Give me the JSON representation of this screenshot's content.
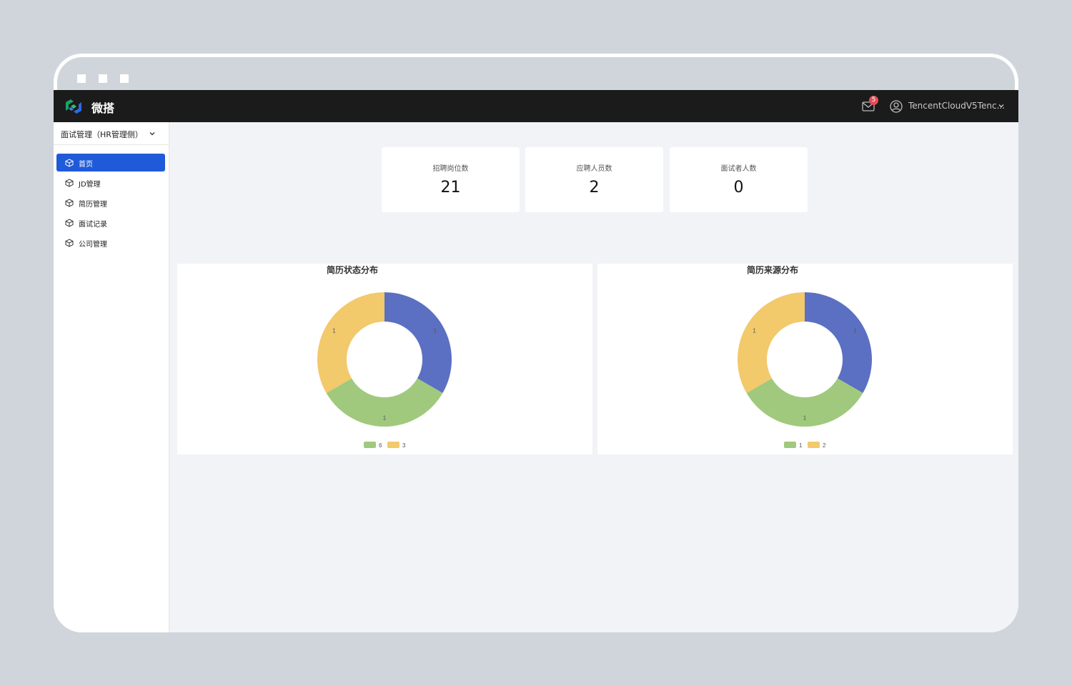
{
  "app": {
    "brand": "微搭"
  },
  "header": {
    "notification_count": "5",
    "username": "TencentCloudV5Tenc..."
  },
  "sidebar": {
    "system_select": "面试管理（HR管理侧）",
    "items": [
      {
        "label": "首页",
        "active": true
      },
      {
        "label": "JD管理",
        "active": false
      },
      {
        "label": "简历管理",
        "active": false
      },
      {
        "label": "面试记录",
        "active": false
      },
      {
        "label": "公司管理",
        "active": false
      }
    ]
  },
  "stats": [
    {
      "label": "招聘岗位数",
      "value": "21"
    },
    {
      "label": "应聘人员数",
      "value": "2"
    },
    {
      "label": "面试者人数",
      "value": "0"
    }
  ],
  "colors": {
    "accent": "#1f5ad8",
    "badge": "#e34d59",
    "series": [
      "#5b70c2",
      "#a0c97d",
      "#f2c96b"
    ]
  },
  "chart_data": [
    {
      "type": "pie",
      "title": "简历状态分布",
      "slices": [
        {
          "label": "",
          "value": 1,
          "color": "#5b70c2"
        },
        {
          "label": "",
          "value": 1,
          "color": "#a0c97d"
        },
        {
          "label": "",
          "value": 1,
          "color": "#f2c96b"
        }
      ],
      "legend": [
        {
          "name": "6",
          "color": "#a0c97d"
        },
        {
          "name": "3",
          "color": "#f2c96b"
        }
      ],
      "legend_position": "bottom",
      "donut": true
    },
    {
      "type": "pie",
      "title": "简历来源分布",
      "slices": [
        {
          "label": "",
          "value": 1,
          "color": "#5b70c2"
        },
        {
          "label": "",
          "value": 1,
          "color": "#a0c97d"
        },
        {
          "label": "",
          "value": 1,
          "color": "#f2c96b"
        }
      ],
      "legend": [
        {
          "name": "1",
          "color": "#a0c97d"
        },
        {
          "name": "2",
          "color": "#f2c96b"
        }
      ],
      "legend_position": "bottom",
      "donut": true
    }
  ]
}
